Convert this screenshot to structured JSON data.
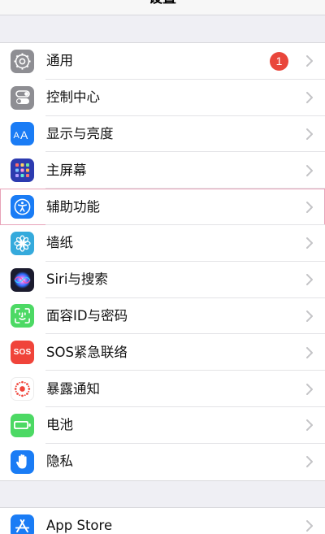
{
  "nav": {
    "title": "设置"
  },
  "settings": {
    "items": [
      {
        "label": "通用",
        "icon": "gear-icon",
        "badge": "1"
      },
      {
        "label": "控制中心",
        "icon": "toggles-icon"
      },
      {
        "label": "显示与亮度",
        "icon": "display-brightness-icon"
      },
      {
        "label": "主屏幕",
        "icon": "home-screen-icon"
      },
      {
        "label": "辅助功能",
        "icon": "accessibility-icon",
        "highlighted": true
      },
      {
        "label": "墙纸",
        "icon": "wallpaper-flower-icon"
      },
      {
        "label": "Siri与搜索",
        "icon": "siri-icon"
      },
      {
        "label": "面容ID与密码",
        "icon": "face-id-icon"
      },
      {
        "label": "SOS紧急联络",
        "icon": "sos-icon",
        "icon_text": "SOS"
      },
      {
        "label": "暴露通知",
        "icon": "exposure-notification-icon"
      },
      {
        "label": "电池",
        "icon": "battery-icon"
      },
      {
        "label": "隐私",
        "icon": "privacy-hand-icon"
      }
    ]
  },
  "store": {
    "items": [
      {
        "label": "App Store",
        "icon": "app-store-icon"
      }
    ]
  },
  "colors": {
    "gray_icon": "#8e8e93",
    "blue_icon": "#1a7cf5",
    "navy_icon": "#2c3bb0",
    "teal_icon": "#35aadc",
    "green_icon": "#4cd964",
    "red_icon": "#f0443a",
    "badge_red": "#e9463b",
    "highlight_outline": "#e7a2b8"
  }
}
